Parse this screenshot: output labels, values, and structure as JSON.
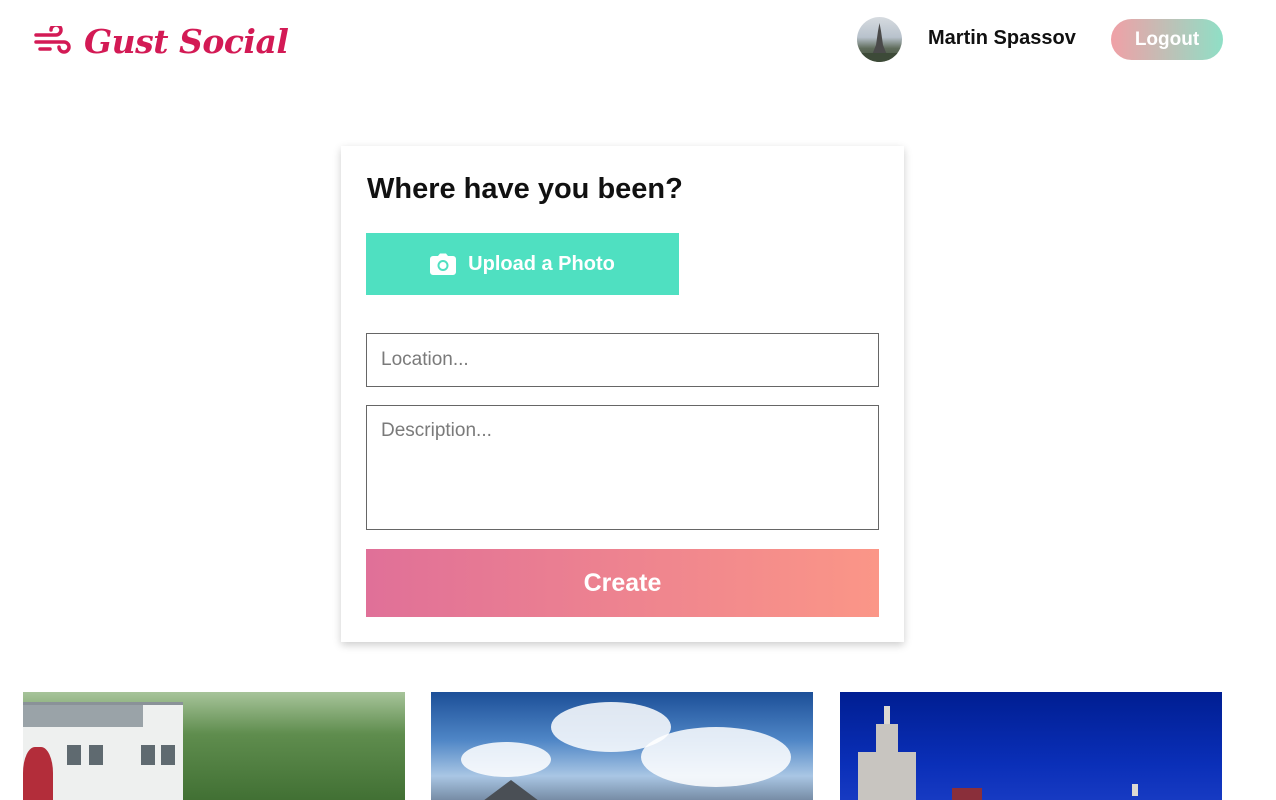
{
  "header": {
    "brand": "Gust Social",
    "user_name": "Martin Spassov",
    "logout_label": "Logout",
    "brand_color": "#d31a55"
  },
  "form": {
    "title": "Where have you been?",
    "upload_label": "Upload a Photo",
    "location_placeholder": "Location...",
    "description_placeholder": "Description...",
    "create_label": "Create",
    "upload_color": "#4fe0c1"
  },
  "icons": {
    "brand": "wind-icon",
    "upload": "camera-icon"
  },
  "photos": [
    {
      "subject": "house"
    },
    {
      "subject": "mountains-clouds"
    },
    {
      "subject": "city-skyline"
    }
  ]
}
